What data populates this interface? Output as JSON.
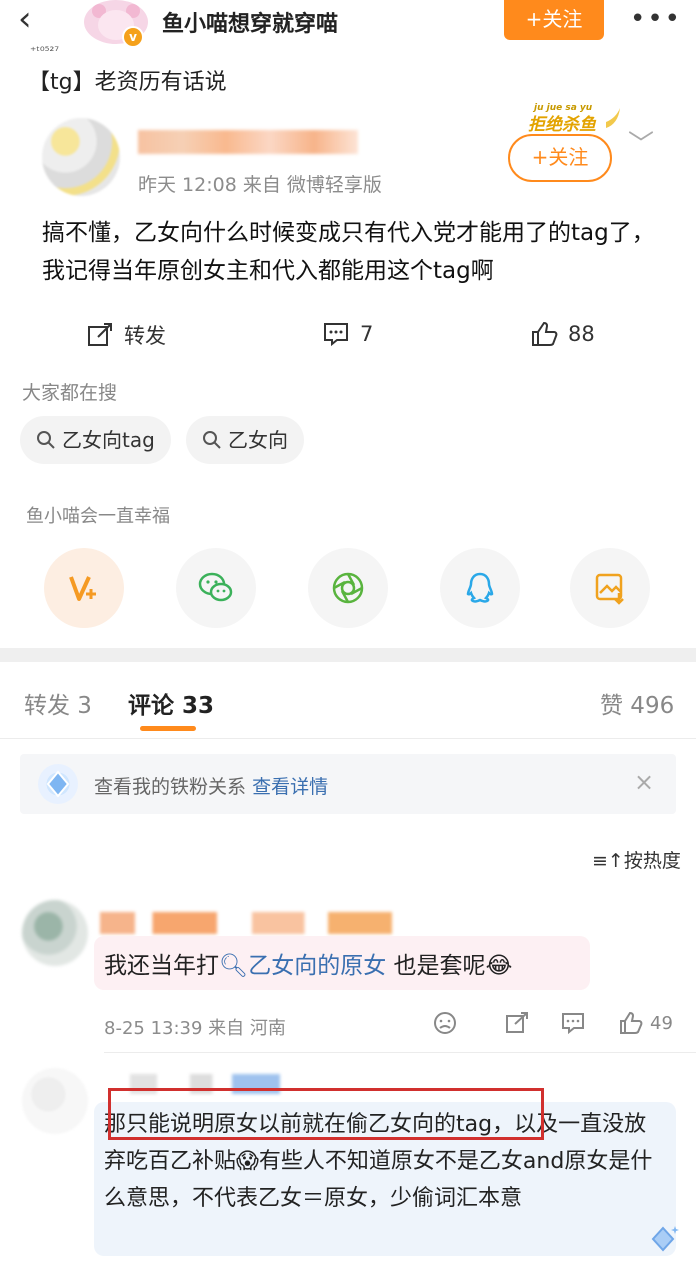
{
  "header": {
    "back_icon": "‹",
    "title": "鱼小喵想穿就穿喵",
    "follow_label": "+关注",
    "more_icon": "•••",
    "vbadge": "v"
  },
  "post": {
    "partial_top": "⁺ᵗ⁰⁵²⁷",
    "tag_line": "【tg】老资历有话说",
    "meta": "昨天 12:08  来自 微博轻享版",
    "follow_label": "+关注",
    "deco_text": "ju jue sa yu 拒绝杀鱼",
    "body": "搞不懂，乙女向什么时候变成只有代入党才能用了的tag了，我记得当年原创女主和代入都能用这个tag啊",
    "actions": {
      "repost": "转发",
      "comments": "7",
      "likes": "88"
    }
  },
  "hot_search": {
    "label": "大家都在搜",
    "chips": [
      "乙女向tag",
      "乙女向"
    ]
  },
  "wish_text": "鱼小喵会一直幸福",
  "share_icons": [
    "weibo-v-icon",
    "wechat-icon",
    "moments-icon",
    "qq-icon",
    "save-image-icon"
  ],
  "tabs": {
    "repost": "转发 3",
    "comment": "评论 33",
    "like": "赞 496"
  },
  "fan_banner": {
    "text": "查看我的铁粉关系",
    "link": "查看详情",
    "close": "×"
  },
  "sort_label": "≡↑按热度",
  "comments": [
    {
      "text_before": "我还当年打",
      "link": "乙女向的原女",
      "text_after": " 也是套呢😂",
      "meta": "8-25 13:39 来自 河南",
      "likes": "49"
    },
    {
      "text": "那只能说明原女以前就在偷乙女向的tag，以及一直没放弃吃百乙补贴😱有些人不知道原女不是乙女and原女是什么意思，不代表乙女＝原女，少偷词汇本意"
    }
  ],
  "colors": {
    "accent": "#ff8a1c",
    "link": "#3a6fb0",
    "highlight_box": "#d1302e"
  }
}
